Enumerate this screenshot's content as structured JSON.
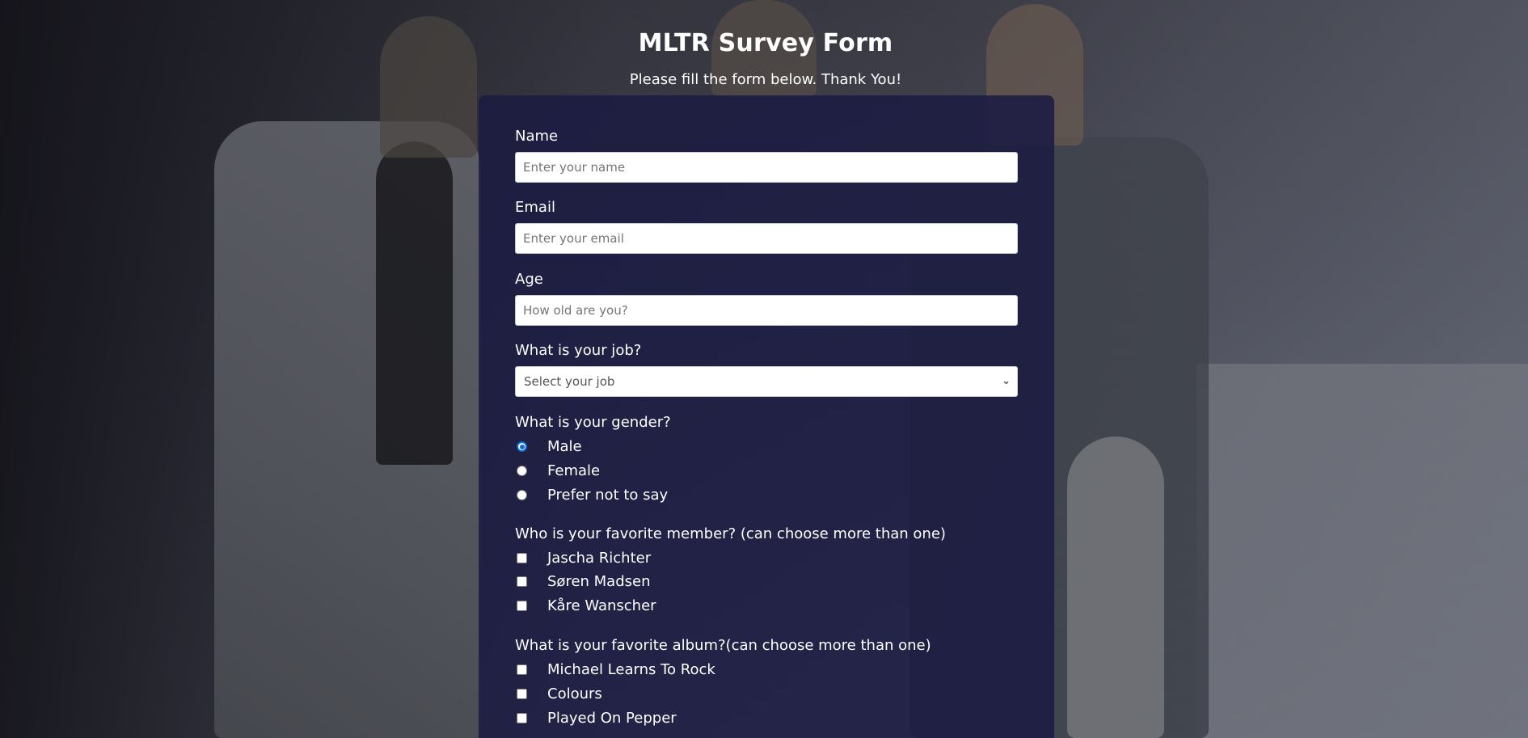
{
  "header": {
    "title": "MLTR Survey Form",
    "subtitle": "Please fill the form below. Thank You!"
  },
  "form": {
    "name": {
      "label": "Name",
      "placeholder": "Enter your name",
      "value": ""
    },
    "email": {
      "label": "Email",
      "placeholder": "Enter your email",
      "value": ""
    },
    "age": {
      "label": "Age",
      "placeholder": "How old are you?",
      "value": ""
    },
    "job": {
      "label": "What is your job?",
      "selected": "Select your job",
      "icon": "chevron-down-icon"
    },
    "gender": {
      "label": "What is your gender?",
      "options": [
        {
          "label": "Male",
          "checked": true
        },
        {
          "label": "Female",
          "checked": false
        },
        {
          "label": "Prefer not to say",
          "checked": false
        }
      ]
    },
    "member": {
      "label": "Who is your favorite member? (can choose more than one)",
      "options": [
        {
          "label": "Jascha Richter",
          "checked": false
        },
        {
          "label": "Søren Madsen",
          "checked": false
        },
        {
          "label": "Kåre Wanscher",
          "checked": false
        }
      ]
    },
    "album": {
      "label": "What is your favorite album?(can choose more than one)",
      "options": [
        {
          "label": "Michael Learns To Rock",
          "checked": false
        },
        {
          "label": "Colours",
          "checked": false
        },
        {
          "label": "Played On Pepper",
          "checked": false
        }
      ]
    }
  },
  "colors": {
    "card": "#1b1b42",
    "radio_accent": "#0b6bd6",
    "text": "#ffffff"
  }
}
